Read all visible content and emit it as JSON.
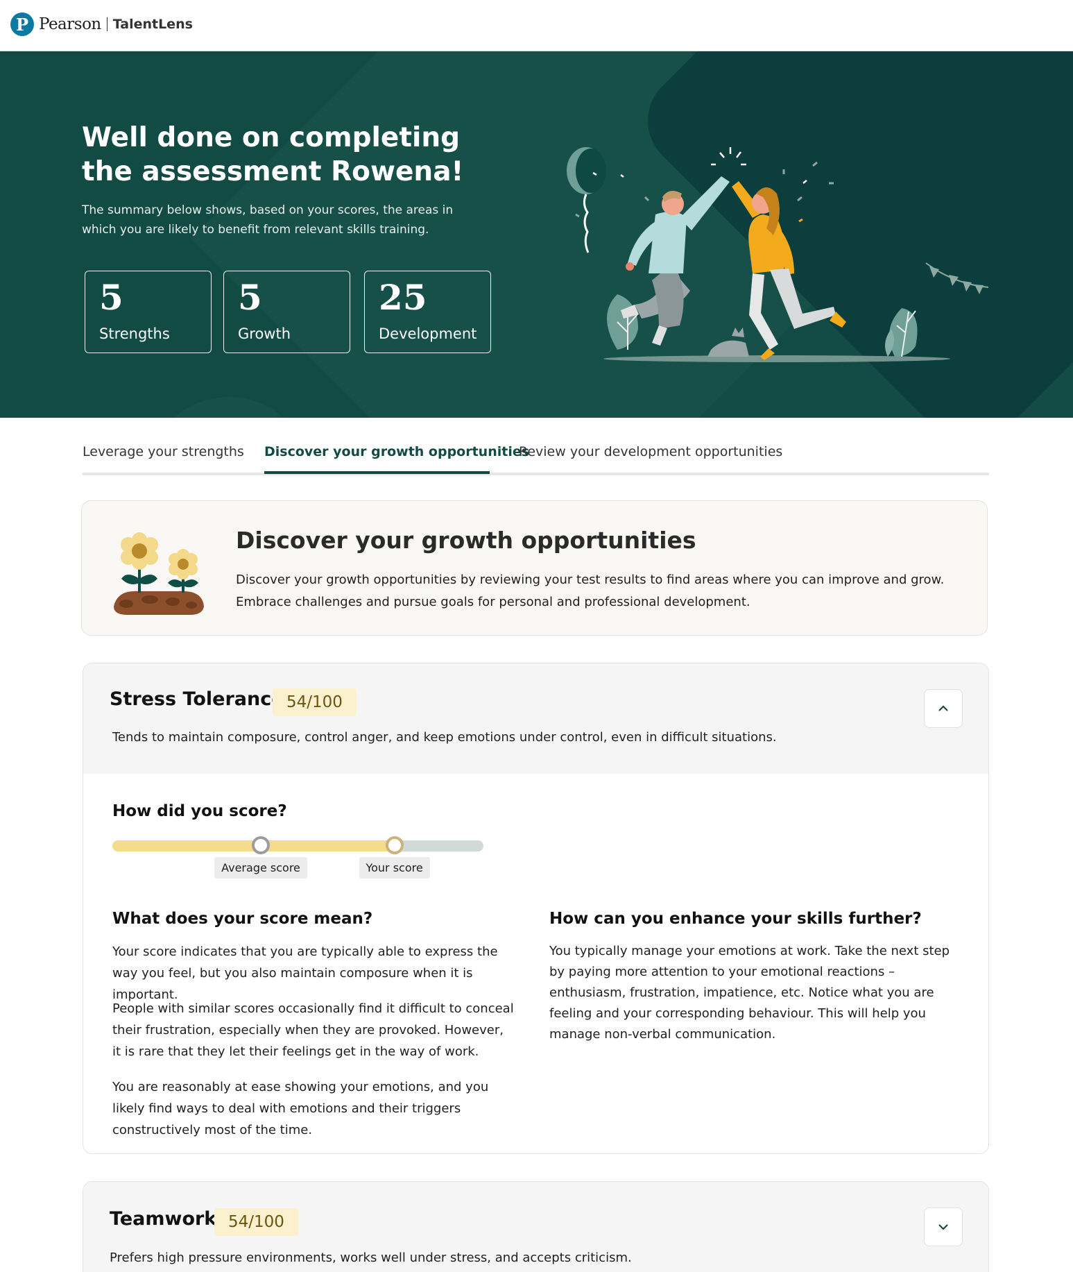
{
  "header": {
    "brand": "Pearson",
    "product": "TalentLens"
  },
  "hero": {
    "title": "Well done on completing the assessment Rowena!",
    "subtitle": "The summary below shows, based on your scores, the areas in which you are likely to benefit from relevant skills training.",
    "stats": [
      {
        "value": "5",
        "label": "Strengths"
      },
      {
        "value": "5",
        "label": "Growth"
      },
      {
        "value": "25",
        "label": "Development"
      }
    ]
  },
  "tabs": [
    {
      "label": "Leverage your strengths",
      "active": false
    },
    {
      "label": "Discover your growth opportunities",
      "active": true
    },
    {
      "label": "Review your development opportunities",
      "active": false
    }
  ],
  "intro": {
    "title": "Discover your growth opportunities",
    "text": "Discover your growth opportunities by reviewing your test results to find areas where you can improve and grow. Embrace challenges and pursue goals for personal and professional development."
  },
  "cards": [
    {
      "name": "Stress Tolerance",
      "score": "54/100",
      "description": "Tends to maintain composure, control anger, and keep emotions under control, even in difficult situations.",
      "expanded": true,
      "score_heading": "How did you score?",
      "average_label": "Average score",
      "your_label": "Your score",
      "average_score": 40,
      "your_score": 76,
      "meaning_heading": "What does your score mean?",
      "meaning_paragraphs": [
        "Your score indicates that you are typically able to express the way you feel, but you also maintain composure when it is important.",
        "People with similar scores occasionally find it difficult to conceal their frustration, especially when they are provoked. However, it is rare that they let their feelings get in the way of work.",
        "You are reasonably at ease showing your emotions, and you likely find ways to deal with emotions and their triggers constructively most of the time."
      ],
      "enhance_heading": "How can you enhance your skills further?",
      "enhance_paragraph": "You typically manage your emotions at work. Take the next step by paying more attention to your emotional reactions – enthusiasm, frustration, impatience, etc. Notice what you are feeling and your corresponding behaviour. This will help you manage non-verbal communication."
    },
    {
      "name": "Teamwork",
      "score": "54/100",
      "description": "Prefers high pressure environments, works well under stress, and accepts criticism.",
      "expanded": false
    }
  ],
  "colors": {
    "brand_dark_green": "#124a44",
    "pearson_blue": "#0b7aa3",
    "score_badge_bg": "#fbf1cf",
    "slider_fill": "#f5dc8d",
    "slider_track": "#cfdad9"
  },
  "icons": {
    "expand_open": "chevron-up-icon",
    "expand_closed": "chevron-down-icon"
  }
}
